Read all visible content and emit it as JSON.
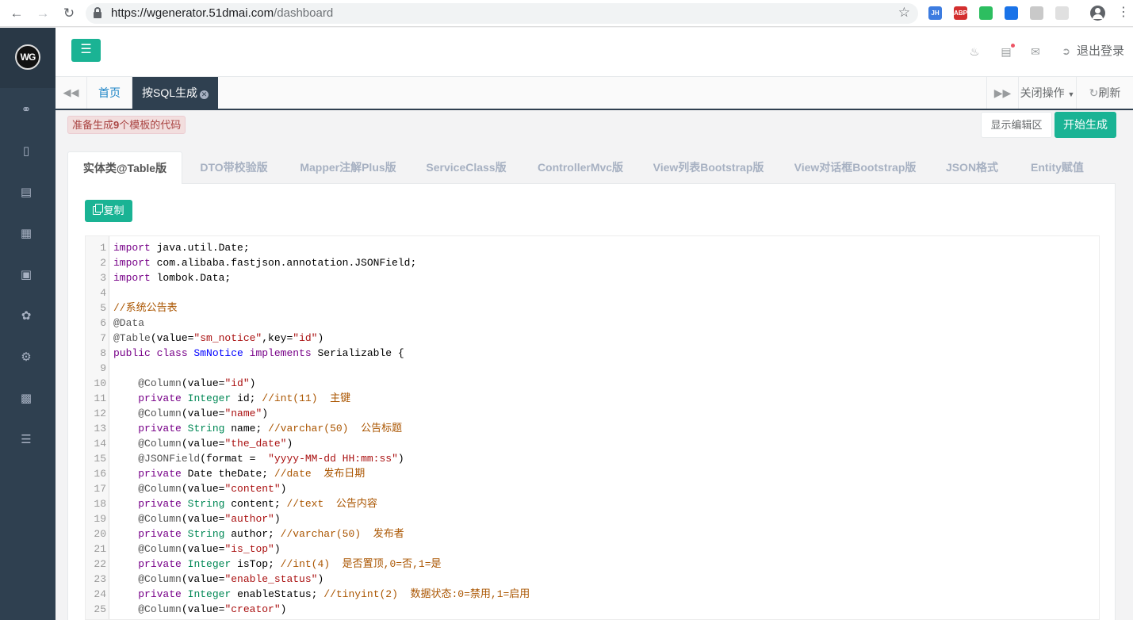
{
  "browser": {
    "url_host": "https://wgenerator.51dmai.com",
    "url_path": "/dashboard",
    "extensions": [
      {
        "label": "JH",
        "color": "#3d7ce0"
      },
      {
        "label": "ABP",
        "color": "#d32f2f"
      },
      {
        "label": "",
        "color": "#2dbe60"
      },
      {
        "label": "",
        "color": "#1a73e8"
      },
      {
        "label": "",
        "color": "#c9c9c9"
      },
      {
        "label": "",
        "color": "#e0e0e0"
      }
    ]
  },
  "sidebar": {
    "logo_text": "WG",
    "icons": [
      "link-icon",
      "mobile-icon",
      "file-code-icon",
      "windows-icon",
      "briefcase-icon",
      "leaf-icon",
      "gear-icon",
      "image-icon",
      "database-icon"
    ]
  },
  "header": {
    "logout_label": "退出登录"
  },
  "tabs": {
    "home": "首页",
    "active": "按SQL生成",
    "close_ops": "关闭操作",
    "refresh": "刷新"
  },
  "toolbar": {
    "notice_prefix": "准备生成",
    "notice_count": "9",
    "notice_suffix": "个模板的代码",
    "show_editor": "显示编辑区",
    "start_generate": "开始生成"
  },
  "code_tabs": [
    "实体类@Table版",
    "DTO带校验版",
    "Mapper注解Plus版",
    "ServiceClass版",
    "ControllerMvc版",
    "View列表Bootstrap版",
    "View对话框Bootstrap版",
    "JSON格式",
    "Entity赋值"
  ],
  "copy_label": "复制",
  "code_lines": [
    [
      [
        "kw",
        "import"
      ],
      [
        "",
        "java.util.Date;"
      ]
    ],
    [
      [
        "kw",
        "import"
      ],
      [
        "",
        "com.alibaba.fastjson.annotation.JSONField;"
      ]
    ],
    [
      [
        "kw",
        "import"
      ],
      [
        "",
        "lombok.Data;"
      ]
    ],
    [],
    [
      [
        "cm",
        "//系统公告表"
      ]
    ],
    [
      [
        "meta",
        "@Data"
      ]
    ],
    [
      [
        "meta",
        "@Table"
      ],
      [
        "",
        "(value="
      ],
      [
        "str",
        "\"sm_notice\""
      ],
      [
        "",
        ",key="
      ],
      [
        "str",
        "\"id\""
      ],
      [
        "",
        ")"
      ]
    ],
    [
      [
        "kw",
        "public"
      ],
      [
        "kw",
        "class"
      ],
      [
        "def",
        "SmNotice"
      ],
      [
        "kw",
        "implements"
      ],
      [
        "",
        "Serializable {"
      ]
    ],
    [],
    [
      [
        "",
        "    "
      ],
      [
        "meta",
        "@Column"
      ],
      [
        "",
        "(value="
      ],
      [
        "str",
        "\"id\""
      ],
      [
        "",
        ")"
      ]
    ],
    [
      [
        "",
        "    "
      ],
      [
        "kw",
        "private"
      ],
      [
        "ty",
        "Integer"
      ],
      [
        "",
        "id;"
      ],
      [
        "cm",
        "//int(11)  主键"
      ]
    ],
    [
      [
        "",
        "    "
      ],
      [
        "meta",
        "@Column"
      ],
      [
        "",
        "(value="
      ],
      [
        "str",
        "\"name\""
      ],
      [
        "",
        ")"
      ]
    ],
    [
      [
        "",
        "    "
      ],
      [
        "kw",
        "private"
      ],
      [
        "ty",
        "String"
      ],
      [
        "",
        "name;"
      ],
      [
        "cm",
        "//varchar(50)  公告标题"
      ]
    ],
    [
      [
        "",
        "    "
      ],
      [
        "meta",
        "@Column"
      ],
      [
        "",
        "(value="
      ],
      [
        "str",
        "\"the_date\""
      ],
      [
        "",
        ")"
      ]
    ],
    [
      [
        "",
        "    "
      ],
      [
        "meta",
        "@JSONField"
      ],
      [
        "",
        "(format = "
      ],
      [
        "str",
        "\"yyyy-MM-dd HH:mm:ss\""
      ],
      [
        "",
        ")"
      ]
    ],
    [
      [
        "",
        "    "
      ],
      [
        "kw",
        "private"
      ],
      [
        "",
        "Date theDate;"
      ],
      [
        "cm",
        "//date  发布日期"
      ]
    ],
    [
      [
        "",
        "    "
      ],
      [
        "meta",
        "@Column"
      ],
      [
        "",
        "(value="
      ],
      [
        "str",
        "\"content\""
      ],
      [
        "",
        ")"
      ]
    ],
    [
      [
        "",
        "    "
      ],
      [
        "kw",
        "private"
      ],
      [
        "ty",
        "String"
      ],
      [
        "",
        "content;"
      ],
      [
        "cm",
        "//text  公告内容"
      ]
    ],
    [
      [
        "",
        "    "
      ],
      [
        "meta",
        "@Column"
      ],
      [
        "",
        "(value="
      ],
      [
        "str",
        "\"author\""
      ],
      [
        "",
        ")"
      ]
    ],
    [
      [
        "",
        "    "
      ],
      [
        "kw",
        "private"
      ],
      [
        "ty",
        "String"
      ],
      [
        "",
        "author;"
      ],
      [
        "cm",
        "//varchar(50)  发布者"
      ]
    ],
    [
      [
        "",
        "    "
      ],
      [
        "meta",
        "@Column"
      ],
      [
        "",
        "(value="
      ],
      [
        "str",
        "\"is_top\""
      ],
      [
        "",
        ")"
      ]
    ],
    [
      [
        "",
        "    "
      ],
      [
        "kw",
        "private"
      ],
      [
        "ty",
        "Integer"
      ],
      [
        "",
        "isTop;"
      ],
      [
        "cm",
        "//int(4)  是否置顶,0=否,1=是"
      ]
    ],
    [
      [
        "",
        "    "
      ],
      [
        "meta",
        "@Column"
      ],
      [
        "",
        "(value="
      ],
      [
        "str",
        "\"enable_status\""
      ],
      [
        "",
        ")"
      ]
    ],
    [
      [
        "",
        "    "
      ],
      [
        "kw",
        "private"
      ],
      [
        "ty",
        "Integer"
      ],
      [
        "",
        "enableStatus;"
      ],
      [
        "cm",
        "//tinyint(2)  数据状态:0=禁用,1=启用"
      ]
    ],
    [
      [
        "",
        "    "
      ],
      [
        "meta",
        "@Column"
      ],
      [
        "",
        "(value="
      ],
      [
        "str",
        "\"creator\""
      ],
      [
        "",
        ")"
      ]
    ]
  ]
}
